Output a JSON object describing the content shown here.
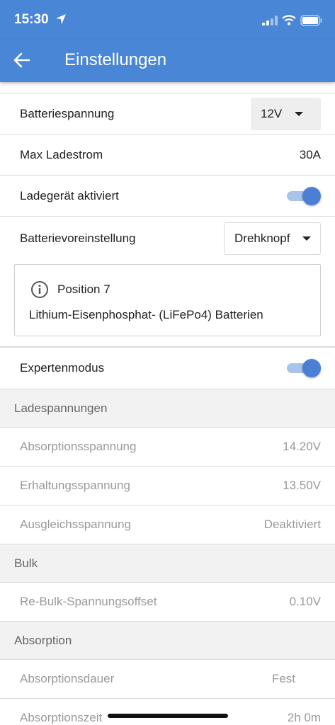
{
  "status": {
    "time": "15:30"
  },
  "appbar": {
    "title": "Einstellungen"
  },
  "settings": {
    "battery_voltage": {
      "label": "Batteriespannung",
      "value": "12V"
    },
    "max_current": {
      "label": "Max Ladestrom",
      "value": "30A"
    },
    "charger_enabled": {
      "label": "Ladegerät aktiviert",
      "on": true
    },
    "battery_preset": {
      "label": "Batterievoreinstellung",
      "value": "Drehknopf"
    },
    "info": {
      "title": "Position 7",
      "text": "Lithium-Eisenphosphat- (LiFePo4) Batterien"
    },
    "expert_mode": {
      "label": "Expertenmodus",
      "on": true
    }
  },
  "sections": {
    "charge_voltages": {
      "title": "Ladespannungen",
      "absorption": {
        "label": "Absorptionsspannung",
        "value": "14.20V"
      },
      "float": {
        "label": "Erhaltungsspannung",
        "value": "13.50V"
      },
      "equalization": {
        "label": "Ausgleichsspannung",
        "value": "Deaktiviert"
      }
    },
    "bulk": {
      "title": "Bulk",
      "rebulk": {
        "label": "Re-Bulk-Spannungsoffset",
        "value": "0.10V"
      }
    },
    "absorption": {
      "title": "Absorption",
      "duration": {
        "label": "Absorptionsdauer",
        "value": "Fest"
      },
      "time": {
        "label": "Absorptionszeit",
        "value": "2h 0m"
      }
    }
  },
  "colors": {
    "accent": "#4a86d6",
    "toggle_on": "#4a7fd4",
    "section_bg": "#f2f2f2"
  }
}
